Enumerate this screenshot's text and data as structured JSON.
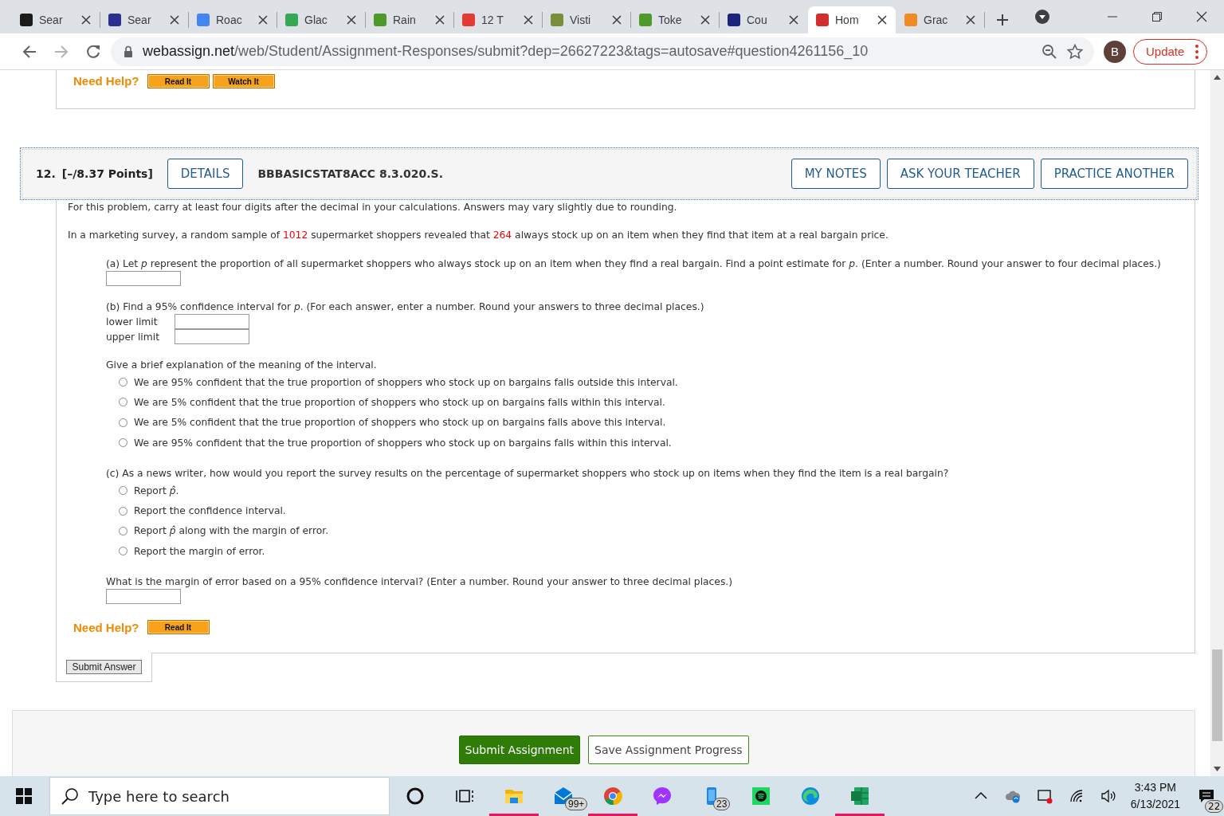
{
  "browser": {
    "tabs": [
      {
        "label": "Sear",
        "color": "#1b1b1b",
        "selected": false
      },
      {
        "label": "Sear",
        "color": "#2b2f8f",
        "selected": false
      },
      {
        "label": "Roac",
        "color": "#4285f4",
        "selected": false
      },
      {
        "label": "Glac",
        "color": "#34a853",
        "selected": false
      },
      {
        "label": "Rain",
        "color": "#4c9a2a",
        "selected": false
      },
      {
        "label": "12 T",
        "color": "#e53935",
        "selected": false
      },
      {
        "label": "Visti",
        "color": "#7a8f3a",
        "selected": false
      },
      {
        "label": "Toke",
        "color": "#4c9a2a",
        "selected": false
      },
      {
        "label": "Cou",
        "color": "#1a237e",
        "selected": false
      },
      {
        "label": "Hom",
        "color": "#d32f2f",
        "selected": true
      },
      {
        "label": "Grac",
        "color": "#f08a24",
        "selected": false
      }
    ],
    "url_host": "webassign.net",
    "url_path": "/web/Student/Assignment-Responses/submit?dep=26627223&tags=autosave#question4261156_10",
    "profile_initial": "B",
    "update_button": "Update"
  },
  "previous_question": {
    "help_label": "Need Help?",
    "help_buttons": [
      "Read It",
      "Watch It"
    ]
  },
  "question": {
    "number": "12.",
    "points": "[–/8.37 Points]",
    "details_button": "DETAILS",
    "code": "BBBASICSTAT8ACC 8.3.020.S.",
    "actions": [
      "MY NOTES",
      "ASK YOUR TEACHER",
      "PRACTICE ANOTHER"
    ],
    "sections": [
      {
        "items": [
          {
            "kind": "lead",
            "text": "For this problem, carry at least four digits after the decimal in your calculations. Answers may vary slightly due to rounding."
          }
        ]
      },
      {
        "items": [
          {
            "kind": "lead_parts",
            "parts": [
              {
                "text": "In a marketing survey, a random sample of ",
                "given": false
              },
              {
                "text": "1012",
                "given": true
              },
              {
                "text": " supermarket shoppers revealed that ",
                "given": false
              },
              {
                "text": "264",
                "given": true
              },
              {
                "text": " always stock up on an item when they find that item at a real bargain price.",
                "given": false
              }
            ]
          },
          {
            "kind": "prompt",
            "text": "(a) Let *p* represent the proportion of all supermarket shoppers who always stock up on an item when they find a real bargain. Find a point estimate for *p*. (Enter a number. Round your answer to four decimal places.)"
          },
          {
            "kind": "field"
          }
        ]
      },
      {
        "items": [
          {
            "kind": "prompt",
            "text": "(b) Find a 95% confidence interval for *p*. (For each answer, enter a number. Round your answers to three decimal places.)"
          },
          {
            "kind": "labeled_field",
            "label": "lower limit"
          },
          {
            "kind": "labeled_field",
            "label": "upper limit"
          }
        ]
      },
      {
        "items": [
          {
            "kind": "prompt",
            "text": "Give a brief explanation of the meaning of the interval."
          },
          {
            "kind": "radio",
            "text": "We are 95% confident that the true proportion of shoppers who stock up on bargains falls outside this interval.",
            "selected": false
          },
          {
            "kind": "radio",
            "text": "We are 5% confident that the true proportion of shoppers who stock up on bargains falls within this interval.",
            "selected": false
          },
          {
            "kind": "radio",
            "text": "We are 5% confident that the true proportion of shoppers who stock up on bargains falls above this interval.",
            "selected": false
          },
          {
            "kind": "radio",
            "text": "We are 95% confident that the true proportion of shoppers who stock up on bargains falls within this interval.",
            "selected": false
          }
        ]
      },
      {
        "items": [
          {
            "kind": "prompt",
            "text": "(c) As a news writer, how would you report the survey results on the percentage of supermarket shoppers who stock up on items when they find the item is a real bargain?"
          },
          {
            "kind": "radio",
            "text": "Report *p̂*.",
            "selected": false
          },
          {
            "kind": "radio",
            "text": "Report the confidence interval.",
            "selected": false
          },
          {
            "kind": "radio",
            "text": "Report *p̂* along with the margin of error.",
            "selected": false
          },
          {
            "kind": "radio",
            "text": "Report the margin of error.",
            "selected": false
          }
        ]
      },
      {
        "items": [
          {
            "kind": "prompt",
            "text": "What is the margin of error based on a 95% confidence interval? (Enter a number. Round your answer to three decimal places.)"
          },
          {
            "kind": "field"
          }
        ]
      }
    ],
    "help_label": "Need Help?",
    "help_buttons": [
      "Read It"
    ],
    "submit_answer": "Submit Answer"
  },
  "footer": {
    "buttons": [
      {
        "label": "Submit Assignment",
        "kind": "primary"
      },
      {
        "label": "Save Assignment Progress",
        "kind": "secondary"
      }
    ]
  },
  "taskbar": {
    "search_placeholder": "Type here to search",
    "apps": [
      {
        "kind": "ring",
        "active": false
      },
      {
        "kind": "taskview",
        "active": false
      },
      {
        "kind": "folder",
        "active": true
      },
      {
        "kind": "mail",
        "active": false,
        "badge": "99+"
      },
      {
        "kind": "chrome",
        "active": true
      },
      {
        "kind": "messenger",
        "active": false
      },
      {
        "kind": "phone",
        "active": false,
        "badge": "23"
      },
      {
        "kind": "music",
        "active": false
      },
      {
        "kind": "edge",
        "active": false
      },
      {
        "kind": "sheet",
        "active": true
      }
    ],
    "time": "3:43 PM",
    "date": "6/13/2021",
    "notifications": "22"
  }
}
